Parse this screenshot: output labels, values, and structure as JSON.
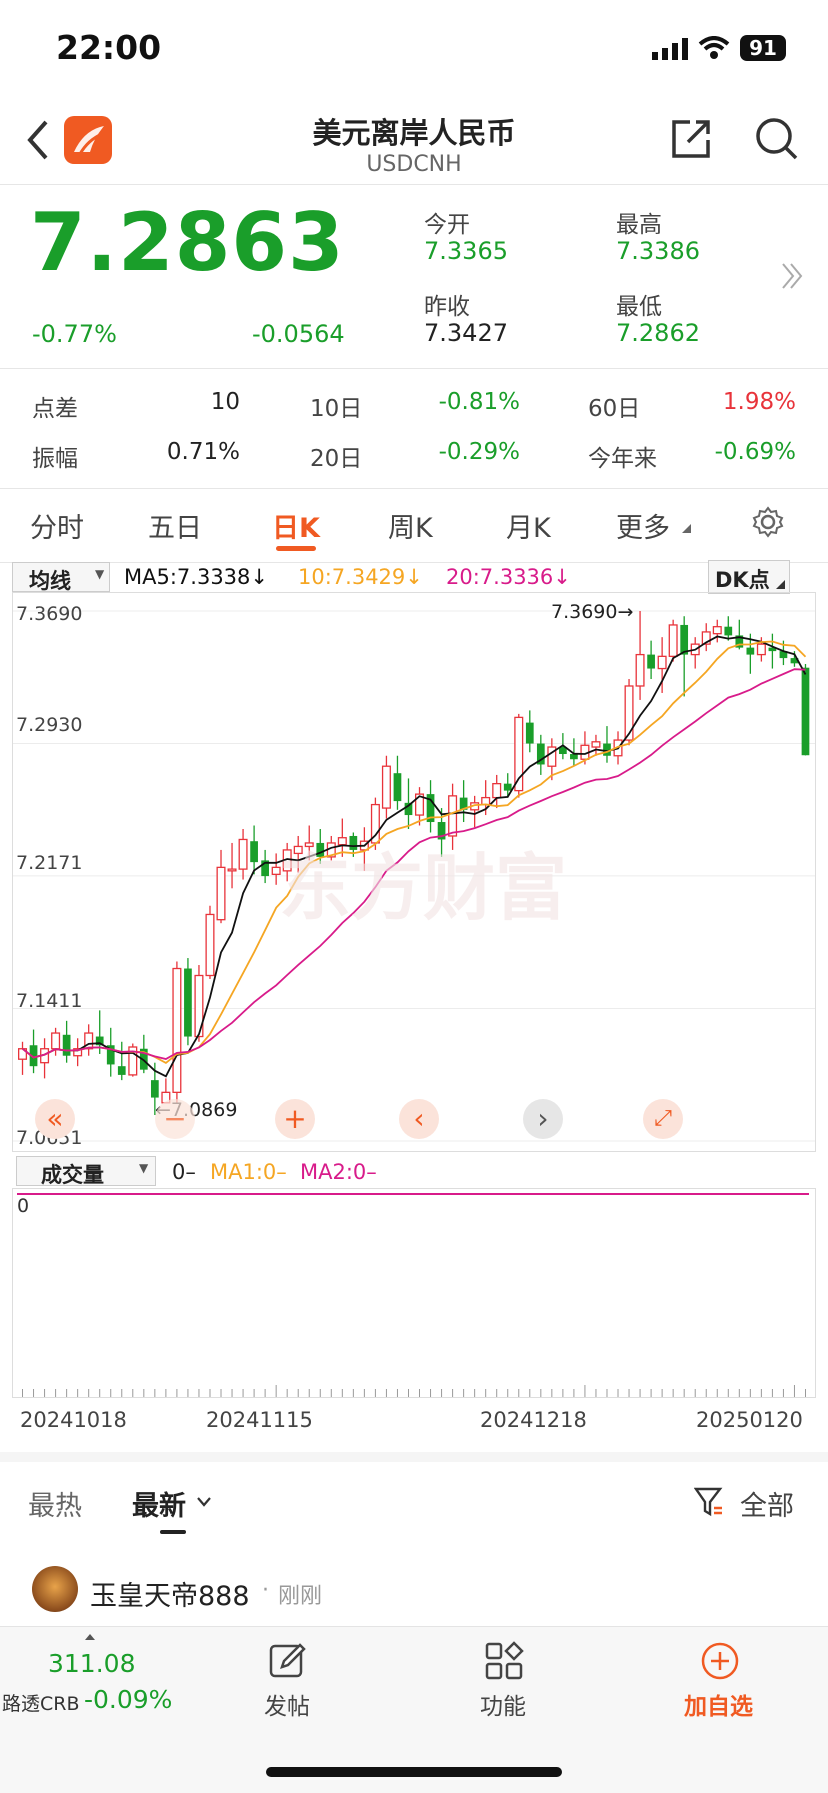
{
  "status_bar": {
    "time": "22:00",
    "battery": "91"
  },
  "header": {
    "title": "美元离岸人民币",
    "subtitle": "USDCNH"
  },
  "quote": {
    "price": "7.2863",
    "change_pct": "-0.77%",
    "change": "-0.0564",
    "open_label": "今开",
    "open": "7.3365",
    "high_label": "最高",
    "high": "7.3386",
    "prev_close_label": "昨收",
    "prev_close": "7.3427",
    "low_label": "最低",
    "low": "7.2862"
  },
  "stats": {
    "spread_label": "点差",
    "spread": "10",
    "d10_label": "10日",
    "d10": "-0.81%",
    "d60_label": "60日",
    "d60": "1.98%",
    "amp_label": "振幅",
    "amp": "0.71%",
    "d20_label": "20日",
    "d20": "-0.29%",
    "ytd_label": "今年来",
    "ytd": "-0.69%"
  },
  "tabs": [
    "分时",
    "五日",
    "日K",
    "周K",
    "月K",
    "更多"
  ],
  "active_tab": "日K",
  "chart_controls": {
    "indicator_select": "均线",
    "ma5": "MA5:7.3338↓",
    "ma10": "10:7.3429↓",
    "ma20": "20:7.3336↓",
    "dk_button": "DK点",
    "y_labels": [
      "7.3690",
      "7.2930",
      "7.2171",
      "7.1411",
      "7.0651"
    ],
    "max_annotation": "7.3690→",
    "min_annotation": "←7.0869",
    "watermark": "东方财富"
  },
  "volume": {
    "select": "成交量",
    "value": "0–",
    "ma1": "MA1:0–",
    "ma2": "MA2:0–",
    "axis_zero": "0"
  },
  "x_dates": [
    "20241018",
    "20241115",
    "20241218",
    "20250120"
  ],
  "colors": {
    "up": "#e8333a",
    "down": "#1a9e2a",
    "ma5": "#111111",
    "ma10": "#f5a623",
    "ma20": "#d81b8a",
    "accent": "#f05a22"
  },
  "chart_data": {
    "type": "candlestick",
    "ylim": [
      7.0651,
      7.369
    ],
    "candles": [
      {
        "o": 7.112,
        "h": 7.122,
        "l": 7.103,
        "c": 7.118
      },
      {
        "o": 7.12,
        "h": 7.129,
        "l": 7.104,
        "c": 7.108
      },
      {
        "o": 7.11,
        "h": 7.124,
        "l": 7.101,
        "c": 7.118
      },
      {
        "o": 7.118,
        "h": 7.13,
        "l": 7.114,
        "c": 7.127
      },
      {
        "o": 7.126,
        "h": 7.134,
        "l": 7.11,
        "c": 7.114
      },
      {
        "o": 7.114,
        "h": 7.124,
        "l": 7.108,
        "c": 7.118
      },
      {
        "o": 7.118,
        "h": 7.132,
        "l": 7.114,
        "c": 7.127
      },
      {
        "o": 7.125,
        "h": 7.14,
        "l": 7.115,
        "c": 7.12
      },
      {
        "o": 7.12,
        "h": 7.13,
        "l": 7.102,
        "c": 7.109
      },
      {
        "o": 7.108,
        "h": 7.122,
        "l": 7.1,
        "c": 7.103
      },
      {
        "o": 7.103,
        "h": 7.121,
        "l": 7.102,
        "c": 7.119
      },
      {
        "o": 7.118,
        "h": 7.126,
        "l": 7.104,
        "c": 7.106
      },
      {
        "o": 7.1,
        "h": 7.11,
        "l": 7.08,
        "c": 7.09
      },
      {
        "o": 7.087,
        "h": 7.101,
        "l": 7.087,
        "c": 7.093
      },
      {
        "o": 7.093,
        "h": 7.168,
        "l": 7.0869,
        "c": 7.164
      },
      {
        "o": 7.164,
        "h": 7.17,
        "l": 7.12,
        "c": 7.125
      },
      {
        "o": 7.125,
        "h": 7.166,
        "l": 7.122,
        "c": 7.16
      },
      {
        "o": 7.16,
        "h": 7.2,
        "l": 7.158,
        "c": 7.195
      },
      {
        "o": 7.192,
        "h": 7.232,
        "l": 7.19,
        "c": 7.222
      },
      {
        "o": 7.22,
        "h": 7.236,
        "l": 7.21,
        "c": 7.221
      },
      {
        "o": 7.221,
        "h": 7.244,
        "l": 7.215,
        "c": 7.238
      },
      {
        "o": 7.237,
        "h": 7.246,
        "l": 7.218,
        "c": 7.225
      },
      {
        "o": 7.226,
        "h": 7.232,
        "l": 7.213,
        "c": 7.217
      },
      {
        "o": 7.218,
        "h": 7.23,
        "l": 7.212,
        "c": 7.222
      },
      {
        "o": 7.22,
        "h": 7.236,
        "l": 7.214,
        "c": 7.232
      },
      {
        "o": 7.23,
        "h": 7.24,
        "l": 7.219,
        "c": 7.234
      },
      {
        "o": 7.234,
        "h": 7.246,
        "l": 7.226,
        "c": 7.236
      },
      {
        "o": 7.236,
        "h": 7.244,
        "l": 7.224,
        "c": 7.228
      },
      {
        "o": 7.228,
        "h": 7.24,
        "l": 7.226,
        "c": 7.236
      },
      {
        "o": 7.235,
        "h": 7.25,
        "l": 7.228,
        "c": 7.239
      },
      {
        "o": 7.24,
        "h": 7.242,
        "l": 7.228,
        "c": 7.232
      },
      {
        "o": 7.232,
        "h": 7.245,
        "l": 7.22,
        "c": 7.237
      },
      {
        "o": 7.236,
        "h": 7.262,
        "l": 7.232,
        "c": 7.258
      },
      {
        "o": 7.256,
        "h": 7.286,
        "l": 7.25,
        "c": 7.28
      },
      {
        "o": 7.276,
        "h": 7.286,
        "l": 7.255,
        "c": 7.26
      },
      {
        "o": 7.259,
        "h": 7.273,
        "l": 7.244,
        "c": 7.252
      },
      {
        "o": 7.252,
        "h": 7.268,
        "l": 7.246,
        "c": 7.264
      },
      {
        "o": 7.264,
        "h": 7.272,
        "l": 7.242,
        "c": 7.248
      },
      {
        "o": 7.248,
        "h": 7.256,
        "l": 7.228,
        "c": 7.238
      },
      {
        "o": 7.24,
        "h": 7.27,
        "l": 7.232,
        "c": 7.263
      },
      {
        "o": 7.262,
        "h": 7.272,
        "l": 7.248,
        "c": 7.255
      },
      {
        "o": 7.255,
        "h": 7.263,
        "l": 7.245,
        "c": 7.259
      },
      {
        "o": 7.258,
        "h": 7.272,
        "l": 7.252,
        "c": 7.262
      },
      {
        "o": 7.262,
        "h": 7.275,
        "l": 7.256,
        "c": 7.27
      },
      {
        "o": 7.27,
        "h": 7.276,
        "l": 7.262,
        "c": 7.266
      },
      {
        "o": 7.266,
        "h": 7.31,
        "l": 7.262,
        "c": 7.308
      },
      {
        "o": 7.305,
        "h": 7.312,
        "l": 7.288,
        "c": 7.293
      },
      {
        "o": 7.293,
        "h": 7.298,
        "l": 7.275,
        "c": 7.281
      },
      {
        "o": 7.28,
        "h": 7.296,
        "l": 7.272,
        "c": 7.291
      },
      {
        "o": 7.291,
        "h": 7.299,
        "l": 7.284,
        "c": 7.287
      },
      {
        "o": 7.287,
        "h": 7.296,
        "l": 7.28,
        "c": 7.284
      },
      {
        "o": 7.284,
        "h": 7.3,
        "l": 7.281,
        "c": 7.292
      },
      {
        "o": 7.291,
        "h": 7.298,
        "l": 7.286,
        "c": 7.294
      },
      {
        "o": 7.293,
        "h": 7.303,
        "l": 7.282,
        "c": 7.286
      },
      {
        "o": 7.286,
        "h": 7.3,
        "l": 7.281,
        "c": 7.295
      },
      {
        "o": 7.295,
        "h": 7.33,
        "l": 7.292,
        "c": 7.326
      },
      {
        "o": 7.326,
        "h": 7.369,
        "l": 7.318,
        "c": 7.344
      },
      {
        "o": 7.344,
        "h": 7.352,
        "l": 7.33,
        "c": 7.336
      },
      {
        "o": 7.336,
        "h": 7.354,
        "l": 7.322,
        "c": 7.343
      },
      {
        "o": 7.343,
        "h": 7.364,
        "l": 7.34,
        "c": 7.361
      },
      {
        "o": 7.361,
        "h": 7.366,
        "l": 7.32,
        "c": 7.344
      },
      {
        "o": 7.344,
        "h": 7.354,
        "l": 7.336,
        "c": 7.35
      },
      {
        "o": 7.35,
        "h": 7.362,
        "l": 7.346,
        "c": 7.357
      },
      {
        "o": 7.356,
        "h": 7.364,
        "l": 7.351,
        "c": 7.36
      },
      {
        "o": 7.36,
        "h": 7.366,
        "l": 7.352,
        "c": 7.355
      },
      {
        "o": 7.355,
        "h": 7.364,
        "l": 7.347,
        "c": 7.348
      },
      {
        "o": 7.348,
        "h": 7.356,
        "l": 7.333,
        "c": 7.344
      },
      {
        "o": 7.344,
        "h": 7.354,
        "l": 7.34,
        "c": 7.35
      },
      {
        "o": 7.348,
        "h": 7.356,
        "l": 7.336,
        "c": 7.346
      },
      {
        "o": 7.346,
        "h": 7.352,
        "l": 7.338,
        "c": 7.342
      },
      {
        "o": 7.342,
        "h": 7.346,
        "l": 7.337,
        "c": 7.339
      },
      {
        "o": 7.3365,
        "h": 7.3386,
        "l": 7.2862,
        "c": 7.2863
      }
    ]
  },
  "feed": {
    "tabs": [
      "最热",
      "最新"
    ],
    "active_tab": "最新",
    "filter_label": "全部",
    "post_user": "玉皇天帝888",
    "post_time": "刚刚"
  },
  "bottom_bar": {
    "ticker_value": "311.08",
    "ticker_name": "路透CRB",
    "ticker_change": "-0.09%",
    "post_label": "发帖",
    "func_label": "功能",
    "add_label": "加自选"
  }
}
